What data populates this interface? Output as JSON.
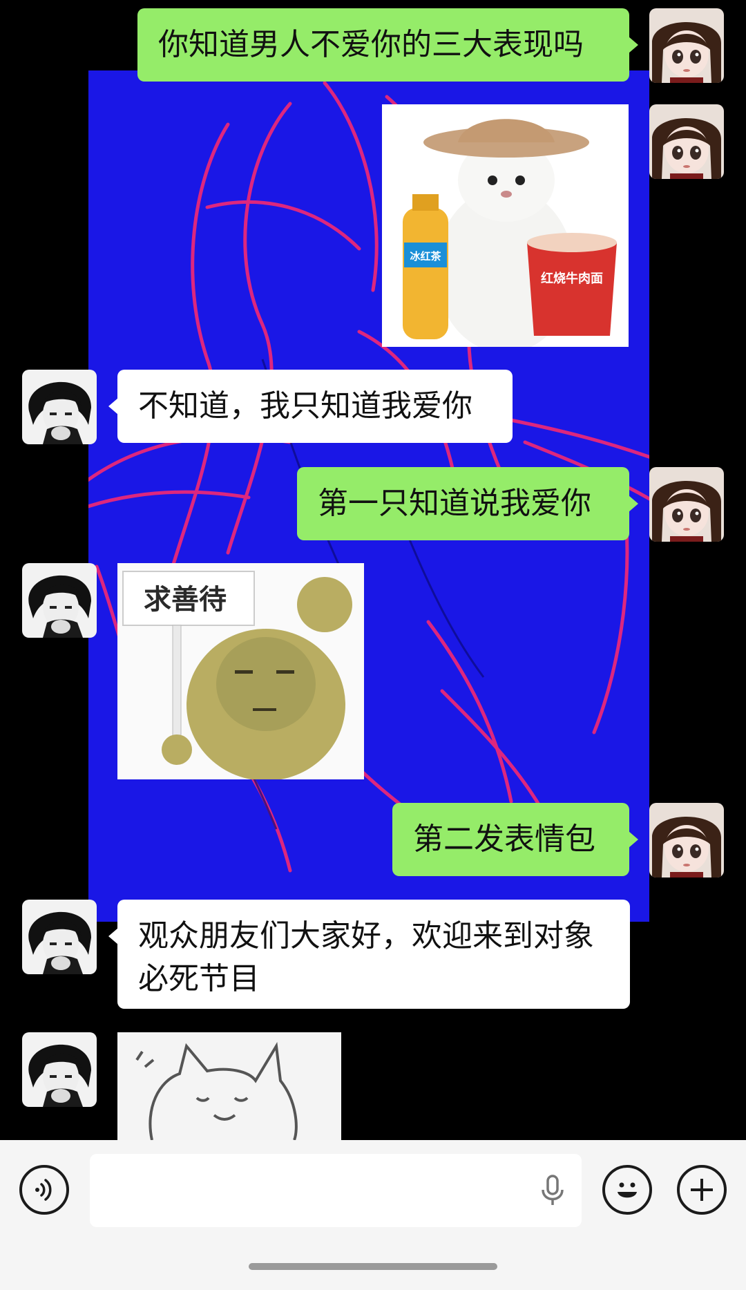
{
  "messages": [
    {
      "side": "right",
      "type": "text",
      "text": "你知道男人不爱你的三大表现吗"
    },
    {
      "side": "right",
      "type": "sticker",
      "sticker_name": "cat-with-hat-sticker",
      "labels": {
        "drink": "冰红茶",
        "noodle": "红烧牛肉面"
      }
    },
    {
      "side": "left",
      "type": "text",
      "text": "不知道，我只知道我爱你"
    },
    {
      "side": "right",
      "type": "text",
      "text": "第一只知道说我爱你"
    },
    {
      "side": "left",
      "type": "sticker",
      "sticker_name": "bear-sign-sticker",
      "sign_text": "求善待"
    },
    {
      "side": "right",
      "type": "text",
      "text": "第二发表情包"
    },
    {
      "side": "left",
      "type": "text",
      "text": "观众朋友们大家好，欢迎来到对象必死节目",
      "lines": [
        "观众朋友们大家好，欢迎来到对象",
        "必死节目"
      ]
    },
    {
      "side": "left",
      "type": "sticker",
      "sticker_name": "cat-sketch-sticker"
    }
  ],
  "input_bar": {
    "voice_icon": "voice-wave-icon",
    "mic_icon": "microphone-icon",
    "emoji_icon": "smile-face-icon",
    "plus_icon": "plus-icon",
    "input_value": ""
  },
  "colors": {
    "my_bubble": "#95ec69",
    "their_bubble": "#ffffff",
    "wallpaper_blue": "#1a17e6",
    "wallpaper_lines": "#ff2a6d",
    "bar_bg": "#f5f5f5"
  }
}
